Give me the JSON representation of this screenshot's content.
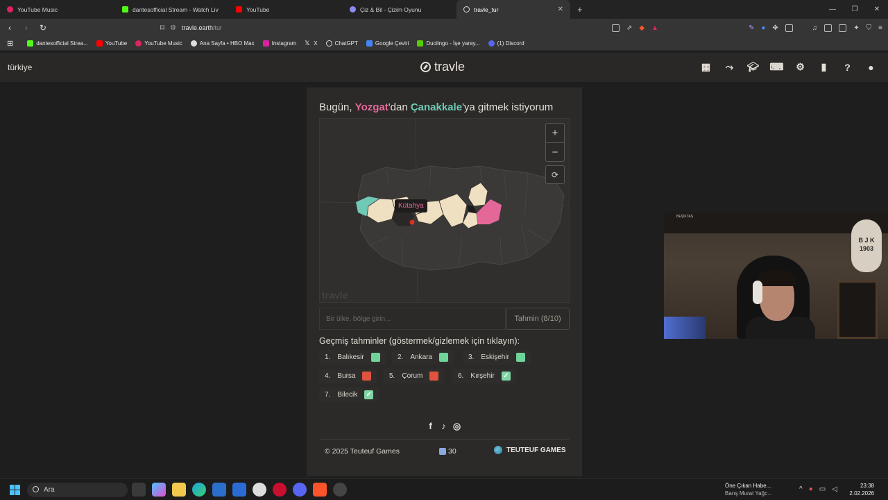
{
  "browser": {
    "tabs": [
      {
        "label": "YouTube Music",
        "color": "#e0245e"
      },
      {
        "label": "dantesofficial Stream - Watch Liv",
        "color": "#53fc18"
      },
      {
        "label": "YouTube",
        "color": "#ff0000"
      },
      {
        "label": "Çiz & Bil - Çizim Oyunu",
        "color": "#8a8af0"
      },
      {
        "label": "travle_tur",
        "color": "#dddddd",
        "active": true
      }
    ],
    "address": {
      "domain": "travle.earth",
      "path": "/tur"
    },
    "bookmarks": [
      {
        "label": "dantesofficial Strea...",
        "color": "#53fc18"
      },
      {
        "label": "YouTube",
        "color": "#ff0000"
      },
      {
        "label": "YouTube Music",
        "color": "#e0245e"
      },
      {
        "label": "Ana Sayfa • HBO Max",
        "color": "#ffffff"
      },
      {
        "label": "Instagram",
        "color": "#d6249f"
      },
      {
        "label": "X",
        "color": "#ffffff"
      },
      {
        "label": "ChatGPT",
        "color": "#ffffff"
      },
      {
        "label": "Google Çeviri",
        "color": "#4285f4"
      },
      {
        "label": "Duolingo - İşe yaray...",
        "color": "#58cc02"
      },
      {
        "label": "(1) Discord",
        "color": "#5865f2"
      }
    ]
  },
  "header": {
    "region": "türkiye",
    "brand": "travle",
    "icons": [
      "calendar-icon",
      "route-icon",
      "graduation-cap-icon",
      "gamepad-icon",
      "gear-icon",
      "bar-chart-icon",
      "help-icon",
      "user-icon"
    ]
  },
  "game": {
    "prompt_prefix": "Bugün, ",
    "start": "Yozgat",
    "prompt_middle": "'dan ",
    "end": "Çanakkale",
    "prompt_suffix": "'ya gitmek istiyorum",
    "map_tooltip": "Kütahya",
    "map_watermark": "travle",
    "zoom_in": "+",
    "zoom_out": "−",
    "reset": "⟳",
    "input_placeholder": "Bir ülke, bölge girin...",
    "guess_button": "Tahmin (8/10)",
    "history_title": "Geçmiş tahminler (göstermek/gizlemek için tıklayın):",
    "history": [
      {
        "num": "1.",
        "name": "Balıkesir",
        "status": "green"
      },
      {
        "num": "2.",
        "name": "Ankara",
        "status": "green"
      },
      {
        "num": "3.",
        "name": "Eskişehir",
        "status": "green"
      },
      {
        "num": "4.",
        "name": "Bursa",
        "status": "red"
      },
      {
        "num": "5.",
        "name": "Çorum",
        "status": "red"
      },
      {
        "num": "6.",
        "name": "Kırşehir",
        "status": "check"
      },
      {
        "num": "7.",
        "name": "Bilecik",
        "status": "check"
      }
    ],
    "colors": {
      "start": "#e4679a",
      "end": "#6fc9b4",
      "green": "#6fd49a",
      "red": "#e0533f",
      "path": "#efe0c2"
    }
  },
  "footer": {
    "copyright": "© 2025 Teuteuf Games",
    "streak": "30",
    "company": "TEUTEUF GAMES"
  },
  "webcam": {
    "shelf_label": "BEŞİKTAŞ",
    "crest_text": "B J K 1903"
  },
  "taskbar": {
    "search": "Ara",
    "news_title": "Öne Çıkan Habe...",
    "news_sub": "Barış Murat Yağc...",
    "time": "23:38",
    "date": "2.02.2026"
  }
}
